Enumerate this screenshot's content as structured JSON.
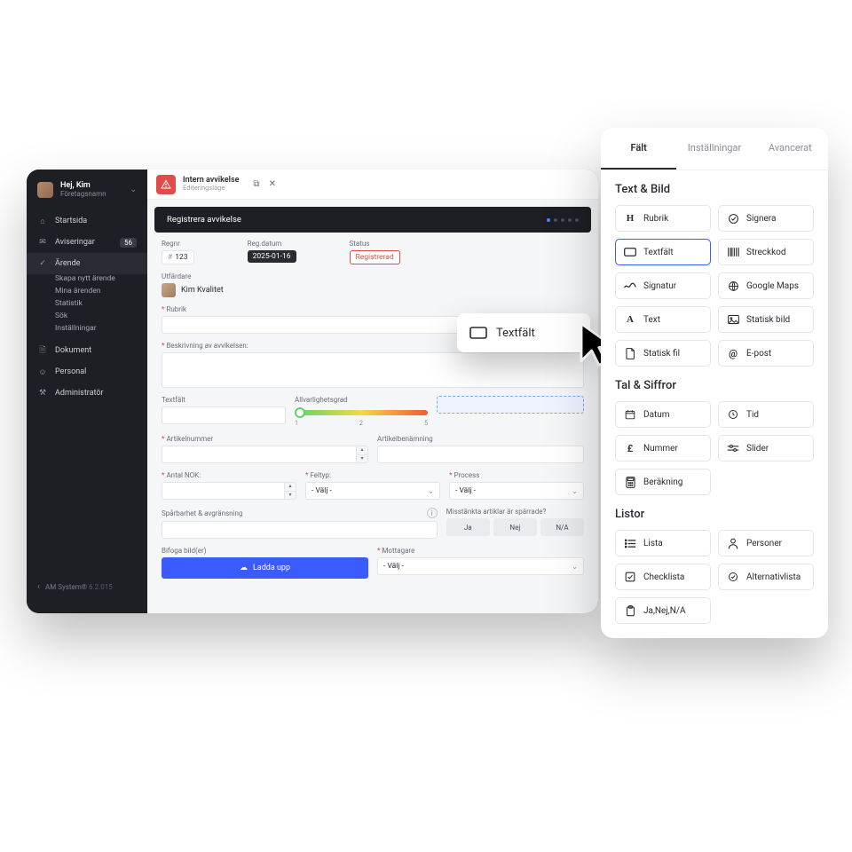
{
  "sidebar": {
    "greeting": "Hej, Kim",
    "company": "Företagsnamn",
    "nav": {
      "start": "Startsida",
      "notifications": "Aviseringar",
      "notifications_count": "56",
      "case": "Ärende",
      "document": "Dokument",
      "personal": "Personal",
      "admin": "Administratör"
    },
    "subnav": [
      "Skapa nytt ärende",
      "Mina ärenden",
      "Statistik",
      "Sök",
      "Inställningar"
    ],
    "footer": {
      "product": "AM System®",
      "version": "6.2.015"
    }
  },
  "topbar": {
    "title": "Intern avvikelse",
    "subtitle": "Editeringsläge"
  },
  "header": {
    "title": "Registrera avvikelse"
  },
  "form": {
    "regnr_label": "Regnr",
    "regnr_value": "123",
    "regdate_label": "Reg.datum",
    "regdate_value": "2025-01-16",
    "status_label": "Status",
    "status_value": "Registrerad",
    "issuer_label": "Utfärdare",
    "issuer_name": "Kim Kvalitet",
    "rubrik": "Rubrik",
    "beskrivning": "Beskrivning av avvikelsen:",
    "textfalt": "Textfält",
    "severity_label": "Allvarlighetsgrad",
    "severity_ticks": [
      "1",
      "2",
      "5"
    ],
    "artikelnr": "Artikelnummer",
    "artikelben": "Artikelbenämning",
    "antal": "Antal NOK:",
    "feltyp": "Feltyp:",
    "process": "Process",
    "select_placeholder": "- Välj -",
    "trace": "Spårbarhet & avgränsning",
    "suspect": "Misstänkta artiklar är spärrade?",
    "seg": [
      "Ja",
      "Nej",
      "N/A"
    ],
    "attach": "Bifoga bild(er)",
    "upload": "Ladda upp",
    "recipient": "Mottagare"
  },
  "dragchip": {
    "label": "Textfält"
  },
  "panel": {
    "tabs": {
      "fields": "Fält",
      "settings": "Inställningar",
      "advanced": "Avancerat"
    },
    "sections": {
      "text": {
        "title": "Text & Bild",
        "items": [
          {
            "icon": "H",
            "label": "Rubrik"
          },
          {
            "icon": "sign",
            "label": "Signera"
          },
          {
            "icon": "rect",
            "label": "Textfält",
            "selected": true
          },
          {
            "icon": "barcode",
            "label": "Streckkod"
          },
          {
            "icon": "squiggle",
            "label": "Signatur"
          },
          {
            "icon": "map",
            "label": "Google Maps"
          },
          {
            "icon": "A",
            "label": "Text"
          },
          {
            "icon": "image",
            "label": "Statisk bild"
          },
          {
            "icon": "file",
            "label": "Statisk fil"
          },
          {
            "icon": "at",
            "label": "E-post"
          }
        ]
      },
      "numbers": {
        "title": "Tal & Siffror",
        "items": [
          {
            "icon": "cal",
            "label": "Datum"
          },
          {
            "icon": "clock",
            "label": "Tid"
          },
          {
            "icon": "pound",
            "label": "Nummer"
          },
          {
            "icon": "slider",
            "label": "Slider"
          },
          {
            "icon": "calc",
            "label": "Beräkning",
            "full": true
          }
        ]
      },
      "lists": {
        "title": "Listor",
        "items": [
          {
            "icon": "list",
            "label": "Lista"
          },
          {
            "icon": "person",
            "label": "Personer"
          },
          {
            "icon": "check",
            "label": "Checklista"
          },
          {
            "icon": "radio",
            "label": "Alternativlista"
          },
          {
            "icon": "clip",
            "label": "Ja,Nej,N/A",
            "full": true
          }
        ]
      }
    }
  }
}
